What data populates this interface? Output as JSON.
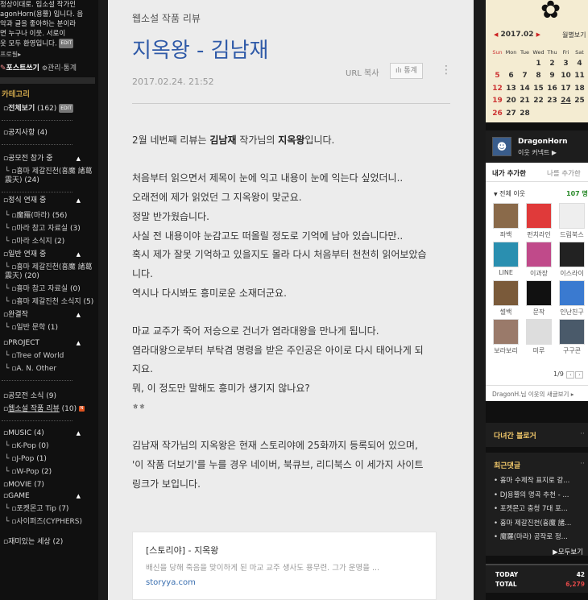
{
  "left": {
    "intro": [
      "정상이대로. 입소설 작가인",
      "agonHorn(용뿔) 입니다. 음",
      "악과 글을 좋아하는 분이라",
      "면 누구나 이웃. 서로이",
      "웃 모두 환영입니다."
    ],
    "intro_edit": "EDIT",
    "profile": "프로필▸",
    "write": "포스트쓰기",
    "manage": "관리",
    "stats": "통계",
    "category_title": "카테고리",
    "categories": [
      {
        "label": "전체보기",
        "count": "(162)",
        "edit": "EDIT"
      },
      {
        "label": "공지사항",
        "count": "(4)"
      },
      {
        "label": "공모전 참가 중",
        "arrow": "▲"
      },
      {
        "label": "흉마 제갈진천(흉魔 諸葛震天)",
        "count": "(24)"
      },
      {
        "label": "정식 연재 중",
        "arrow": "▲"
      },
      {
        "label": "魔羅(마라)",
        "count": "(56)"
      },
      {
        "label": "마라 참고 자료실",
        "count": "(3)"
      },
      {
        "label": "마라 소식지",
        "count": "(2)"
      },
      {
        "label": "일반 연재 중",
        "arrow": "▲"
      },
      {
        "label": "흉마 제갈진천(흉魔 諸葛震天)",
        "count": "(20)"
      },
      {
        "label": "흉마 참고 자료실",
        "count": "(0)"
      },
      {
        "label": "흉마 제갈진천 소식지",
        "count": "(5)"
      },
      {
        "label": "완결작",
        "arrow": "▲"
      },
      {
        "label": "일반 문학",
        "count": "(1)"
      },
      {
        "label": "PROJECT",
        "arrow": "▲"
      },
      {
        "label": "Tree of World",
        "count": ""
      },
      {
        "label": "A. N. Other",
        "count": ""
      },
      {
        "label": "공모전 소식",
        "count": "(9)"
      },
      {
        "label": "웹소설 작품 리뷰",
        "count": "(10)",
        "new": "N"
      },
      {
        "label": "MUSIC",
        "count": "(4)",
        "arrow": "▲"
      },
      {
        "label": "K-Pop",
        "count": "(0)"
      },
      {
        "label": "J-Pop",
        "count": "(1)"
      },
      {
        "label": "W-Pop",
        "count": "(2)"
      },
      {
        "label": "MOVIE",
        "count": "(7)"
      },
      {
        "label": "GAME",
        "arrow": "▲"
      },
      {
        "label": "포켓몬고 Tip",
        "count": "(7)"
      },
      {
        "label": "사이퍼즈(CYPHERS)",
        "count": ""
      },
      {
        "label": "재미있는 세상",
        "count": "(2)"
      }
    ]
  },
  "post": {
    "category": "웹소설 작품 리뷰",
    "title": "지옥왕 - 김남재",
    "date": "2017.02.24. 21:52",
    "url_copy": "URL 복사",
    "stats_btn": "통계",
    "paragraphs": [
      {
        "pre": "2월 네번째 리뷰는 ",
        "b1": "김남재",
        "mid": " 작가님의 ",
        "b2": "지옥왕",
        "post": "입니다."
      },
      {
        "text": ""
      },
      {
        "text": "처음부터 읽으면서 제목이 눈에 익고 내용이 눈에 익는다 싶었더니.."
      },
      {
        "text": "오래전에 제가 읽었던 그 지옥왕이 맞군요."
      },
      {
        "text": "정말 반가웠습니다."
      },
      {
        "text": "사실 전 내용이야 눈감고도 떠올릴 정도로 기억에 남아 있습니다만.."
      },
      {
        "text": "혹시 제가 잘못 기억하고 있을지도 몰라 다시 처음부터 천천히 읽어보았습"
      },
      {
        "text": "니다."
      },
      {
        "text": "역시나 다시봐도 흥미로운 소재더군요."
      },
      {
        "text": ""
      },
      {
        "text": "마교 교주가 죽어 저승으로 건너가 염라대왕을 만나게 됩니다."
      },
      {
        "text": "염라대왕으로부터 부탁겸 명령을 받은 주인공은 아이로 다시 태어나게 되"
      },
      {
        "text": "지요."
      },
      {
        "text": "뭐, 이 정도만 말해도 흥미가 생기지 않나요?"
      },
      {
        "text": "ㅎㅎ",
        "small": true
      },
      {
        "text": ""
      },
      {
        "text": "김남재 작가님의 지옥왕은 현재 스토리야에 25화까지 등록되어 있으며,"
      },
      {
        "text": "'이 작품 더보기'를 누를 경우 네이버, 북큐브, 리디북스 이 세가지 사이트"
      },
      {
        "text": "링크가 보입니다."
      }
    ],
    "link_card": {
      "title": "[스토리야] - 지옥왕",
      "desc": "배신을 당해 죽음을 맞이하게 된 마교 교주 생사도 용무련. 그가 운명을 ...",
      "url": "storyya.com"
    }
  },
  "calendar": {
    "month": "2017.02",
    "view": "월별보기",
    "weekdays": [
      "Sun",
      "Mon",
      "Tue",
      "Wed",
      "Thu",
      "Fri",
      "Sat"
    ],
    "weeks": [
      [
        "",
        "",
        "",
        "1",
        "2",
        "3",
        "4"
      ],
      [
        "5",
        "6",
        "7",
        "8",
        "9",
        "10",
        "11"
      ],
      [
        "12",
        "13",
        "14",
        "15",
        "16",
        "17",
        "18"
      ],
      [
        "19",
        "20",
        "21",
        "22",
        "23",
        "24",
        "25"
      ],
      [
        "26",
        "27",
        "28",
        "",
        "",
        "",
        ""
      ]
    ],
    "today": "24"
  },
  "neighbors": {
    "name": "DragonHorn",
    "connect": "이웃 커넥트",
    "tab_mine": "내가 추가한",
    "tab_others": "나를 추가한",
    "all_label": "전체 이웃",
    "all_count": "107 명",
    "items": [
      {
        "label": "좌백",
        "color": "#8a6a4a"
      },
      {
        "label": "펀치라인",
        "color": "#e03a3a"
      },
      {
        "label": "드림북스",
        "color": "#eeeeee"
      },
      {
        "label": "LINE",
        "color": "#2a8fb0"
      },
      {
        "label": "이과장",
        "color": "#c04a8a"
      },
      {
        "label": "이스라이",
        "color": "#222222"
      },
      {
        "label": "썰백",
        "color": "#7a5a3a"
      },
      {
        "label": "문작",
        "color": "#111111"
      },
      {
        "label": "인난친구",
        "color": "#3a7ad0"
      },
      {
        "label": "보라보리",
        "color": "#9a7a6a"
      },
      {
        "label": "미루",
        "color": "#dddddd"
      },
      {
        "label": "구구콘",
        "color": "#4a5a6a"
      }
    ],
    "page": "1/9",
    "footer": "DragonH.님 이웃의 새글보기 ▸"
  },
  "visited": {
    "title": "다녀간 블로거"
  },
  "recent": {
    "title": "최근댓글",
    "items": [
      "• 흉마 수제작 표지로 갈...",
      "• DJ용뿔의 명곡 추천 - ...",
      "• 포켓몬고 충청 7대 포...",
      "• 흉마 제갈진천(흉魔 諸...",
      "• 魔羅(마라) 공작로 정..."
    ],
    "all_btn": "▶모두보기"
  },
  "stats": {
    "today_label": "TODAY",
    "today_value": "42",
    "total_label": "TOTAL",
    "total_value": "6,279"
  },
  "colors": {
    "accent_title": "#2f5aa8",
    "new_badge": "#e0531f"
  }
}
